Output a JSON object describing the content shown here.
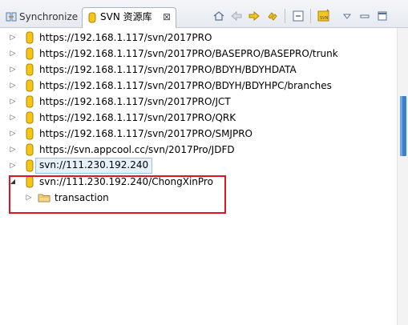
{
  "tabs": [
    {
      "label": "Synchronize",
      "icon": "synchronize-icon",
      "active": false
    },
    {
      "label": "SVN 资源库",
      "icon": "svn-repository-icon",
      "active": true,
      "close": "⊠"
    }
  ],
  "toolbar": [
    "home-icon",
    "back-arrow-icon",
    "forward-arrow-icon",
    "link-with-editor-icon",
    "collapse-all-icon",
    "new-repository-location-icon",
    "view-menu-icon",
    "minimize-icon",
    "maximize-icon"
  ],
  "tree": [
    {
      "label": "https://192.168.1.117/svn/2017PRO",
      "expander": "▷"
    },
    {
      "label": "https://192.168.1.117/svn/2017PRO/BASEPRO/BASEPRO/trunk",
      "expander": "▷"
    },
    {
      "label": "https://192.168.1.117/svn/2017PRO/BDYH/BDYHDATA",
      "expander": "▷"
    },
    {
      "label": "https://192.168.1.117/svn/2017PRO/BDYH/BDYHPC/branches",
      "expander": "▷"
    },
    {
      "label": "https://192.168.1.117/svn/2017PRO/JCT",
      "expander": "▷"
    },
    {
      "label": "https://192.168.1.117/svn/2017PRO/QRK",
      "expander": "▷"
    },
    {
      "label": "https://192.168.1.117/svn/2017PRO/SMJPRO",
      "expander": "▷"
    },
    {
      "label": "https://svn.appcool.cc/svn/2017Pro/JDFD",
      "expander": "▷"
    },
    {
      "label": "svn://111.230.192.240",
      "expander": "▷",
      "selected": true
    },
    {
      "label": "svn://111.230.192.240/ChongXinPro",
      "expander": "◢",
      "expanded": true
    },
    {
      "label": "transaction",
      "expander": "▷",
      "child": true,
      "icon": "folder-icon"
    }
  ],
  "colors": {
    "highlight_border": "#e0141e",
    "selection_bg": "#e6f1fb",
    "scroll_thumb": "#3c7fd0"
  }
}
